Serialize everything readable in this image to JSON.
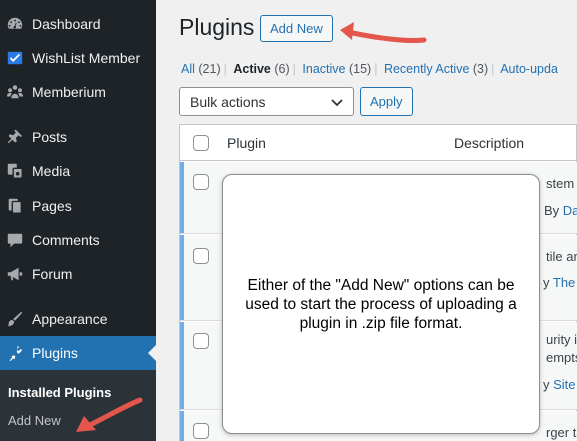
{
  "sidebar": {
    "items": [
      {
        "label": "Dashboard",
        "icon": "dashboard-icon"
      },
      {
        "label": "WishList Member",
        "icon": "wishlist-check-icon"
      },
      {
        "label": "Memberium",
        "icon": "memberium-icon"
      },
      {
        "label": "Posts",
        "icon": "pushpin-icon"
      },
      {
        "label": "Media",
        "icon": "media-icon"
      },
      {
        "label": "Pages",
        "icon": "pages-icon"
      },
      {
        "label": "Comments",
        "icon": "comment-icon"
      },
      {
        "label": "Forum",
        "icon": "megaphone-icon"
      },
      {
        "label": "Appearance",
        "icon": "paintbrush-icon"
      },
      {
        "label": "Plugins",
        "icon": "plugin-icon"
      }
    ],
    "submenu": {
      "current": "Installed Plugins",
      "add_new": "Add New"
    }
  },
  "main": {
    "title": "Plugins",
    "add_new_label": "Add New",
    "filters": [
      {
        "label": "All",
        "count": "(21)"
      },
      {
        "label": "Active",
        "count": "(6)"
      },
      {
        "label": "Inactive",
        "count": "(15)"
      },
      {
        "label": "Recently Active",
        "count": "(3)"
      },
      {
        "label": "Auto-upda",
        "count": ""
      }
    ],
    "separator": "|",
    "bulk_actions": "Bulk actions",
    "apply_label": "Apply",
    "columns": {
      "plugin": "Plugin",
      "description": "Description"
    },
    "rows": [
      {
        "line1": "stem t",
        "line2": "By Da",
        "line2_prefix": "By ",
        "line2_link": "Da"
      },
      {
        "line1": "tile an",
        "line2": "y The",
        "line2_prefix": "y ",
        "line2_link": "The"
      },
      {
        "line1": "urity is",
        "line1b": "empts",
        "line2_prefix": "y ",
        "line2_link": "Site"
      },
      {
        "line1": "rger t"
      }
    ],
    "callout": "Either of the \"Add New\" options can be used to start the process of uploading a plugin in .zip file format."
  },
  "colors": {
    "sidebar_bg": "#1d2327",
    "active_bg": "#2271b1",
    "link": "#2271b1",
    "arrow": "#e4564b"
  }
}
